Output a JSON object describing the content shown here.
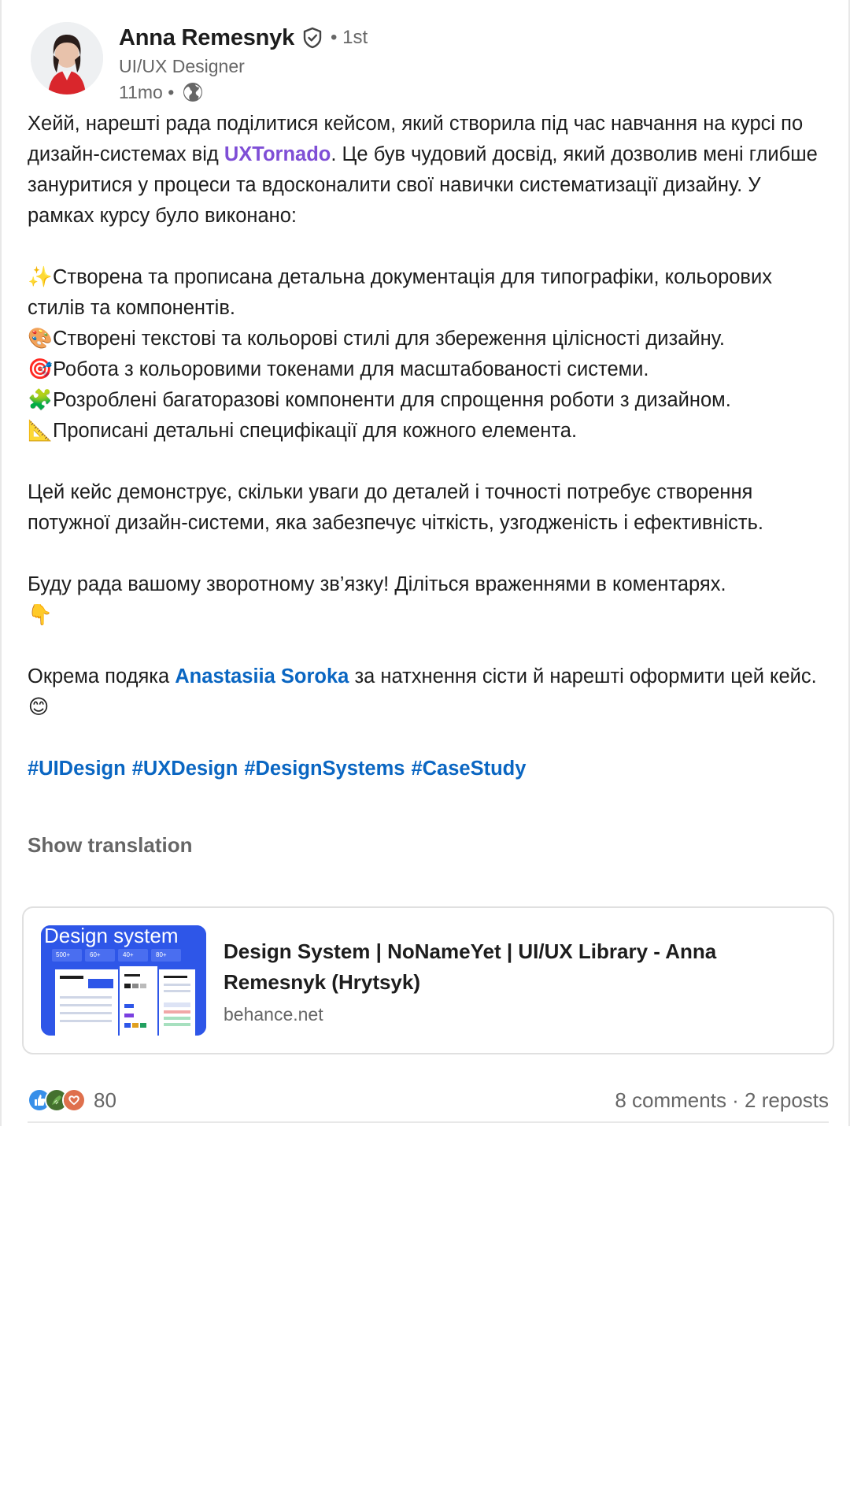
{
  "author": {
    "name": "Anna Remesnyk",
    "degree": "• 1st",
    "headline": "UI/UX Designer",
    "time": "11mo •",
    "icons": [
      "verified-icon",
      "globe-icon"
    ]
  },
  "post": {
    "p1_a": "Хейй, нарешті рада поділитися кейсом, який створила під час навчання на курсі по дизайн-системах від ",
    "p1_mention": "UXTornado",
    "p1_b": ". Це був чудовий досвід, який дозволив мені глибше зануритися у процеси та вдосконалити свої навички систематизації дизайну. У рамках курсу було виконано:",
    "list": [
      {
        "emoji": "✨",
        "text": "Створена та прописана детальна документація для типографіки, кольорових стилів та компонентів."
      },
      {
        "emoji": "🎨",
        "text": "Створені текстові та кольорові стилі для збереження цілісності дизайну."
      },
      {
        "emoji": "🎯",
        "text": "Робота з кольоровими токенами для масштабованості системи."
      },
      {
        "emoji": "🧩",
        "text": "Розроблені багаторазові компоненти для спрощення роботи з дизайном."
      },
      {
        "emoji": "📐",
        "text": "Прописані детальні специфікації для кожного елемента."
      }
    ],
    "p2": "Цей кейс демонструє, скільки уваги до деталей і точності потребує створення потужної дизайн-системи, яка забезпечує чіткість, узгодженість і ефективність.",
    "p3": "Буду рада вашому зворотному зв’язку! Діліться враженнями в коментарях.",
    "p3_emoji": "👇",
    "p4_a": "Окрема подяка ",
    "p4_mention": "Anastasiia Soroka",
    "p4_b": " за натхнення сісти й нарешті оформити цей кейс.",
    "p4_emoji": "😊",
    "hashtags": [
      "#UIDesign",
      "#UXDesign",
      "#DesignSystems",
      "#CaseStudy"
    ],
    "show_translation": "Show translation"
  },
  "preview": {
    "thumb_title": "Design system",
    "thumb_stats": [
      "500+",
      "60+",
      "40+",
      "80+"
    ],
    "title": "Design System | NoNameYet | UI/UX Library - Anna Remesnyk (Hrytsyk)",
    "domain": "behance.net"
  },
  "social": {
    "reaction_icons": [
      "like-icon",
      "celebrate-icon",
      "love-icon"
    ],
    "reaction_count": "80",
    "comments_reposts": "8 comments · 2 reposts"
  },
  "colors": {
    "link_blue": "#0a66c2",
    "company_purple": "#7f4fd6",
    "muted_gray": "#666666",
    "thumb_blue": "#2e56e8"
  }
}
